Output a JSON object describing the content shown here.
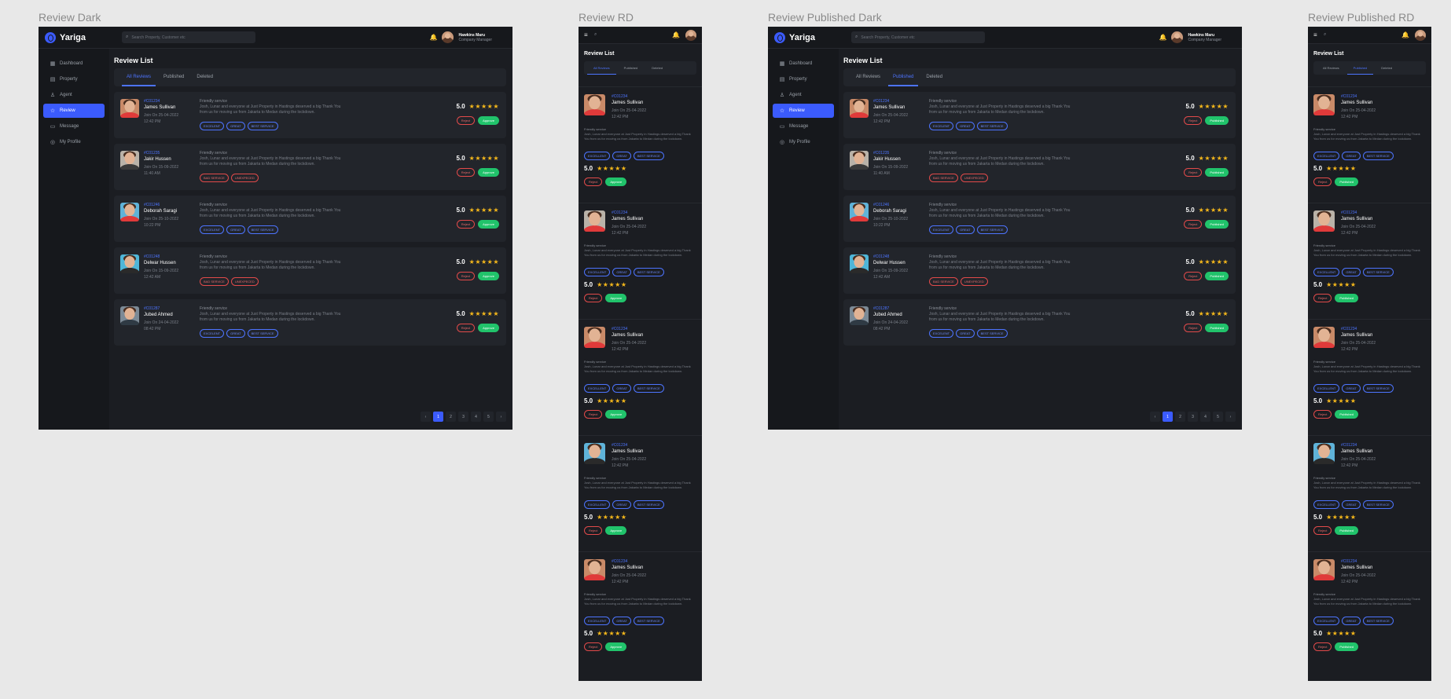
{
  "frames": {
    "review_dark": "Review Dark",
    "review_rd": "Review RD",
    "published_dark": "Review Published Dark",
    "published_rd": "Review Published RD"
  },
  "app": {
    "name": "Yariga"
  },
  "search": {
    "placeholder_dark": "Search Property, Customer etc",
    "placeholder_published": "Search Property, Customer etc"
  },
  "user": {
    "name": "Hawkins Maru",
    "role": "Company Manager"
  },
  "nav": [
    {
      "label": "Dashboard",
      "icon": "grid-icon"
    },
    {
      "label": "Property",
      "icon": "building-icon"
    },
    {
      "label": "Agent",
      "icon": "user-icon"
    },
    {
      "label": "Review",
      "icon": "star-icon"
    },
    {
      "label": "Message",
      "icon": "chat-icon"
    },
    {
      "label": "My Profile",
      "icon": "profile-icon"
    }
  ],
  "page_title": "Review List",
  "tabs": [
    "All Reviews",
    "Published",
    "Deleted"
  ],
  "buttons": {
    "reject": "Reject",
    "approve": "Approve",
    "published": "Published"
  },
  "reviews": [
    {
      "id": "#C01234",
      "name": "James Sullivan",
      "date": "Join On 25-04-2022",
      "time": "12:42 PM",
      "subject": "Friendly service",
      "text": "Josh, Lunar and everyone at Just Property in Hastings deserved a big Thank You from us for moving us from Jakarta to Medan during the lockdown.",
      "tags": [
        "EXCELENT",
        "GREAT",
        "BEST SERVICE"
      ],
      "tag_style": "blue",
      "score": "5.0",
      "avatar_bg": "#c98a68",
      "shirt": "#e03a3a"
    },
    {
      "id": "#C01235",
      "name": "Jakir Hussen",
      "date": "Join On 15-09-2022",
      "time": "11:40 AM",
      "subject": "Friendly service",
      "text": "Josh, Lunar and everyone at Just Property in Hastings deserved a big Thank You from us for moving us from Jakarta to Medan during the lockdown.",
      "tags": [
        "BAD SERVICE",
        "UNEXPECED"
      ],
      "tag_style": "red",
      "score": "5.0",
      "avatar_bg": "#b9b2a8",
      "shirt": "#3a3a3a"
    },
    {
      "id": "#C01246",
      "name": "Deborah Saragi",
      "date": "Join On 25-10-2022",
      "time": "10:22 PM",
      "subject": "Friendly service",
      "text": "Josh, Lunar and everyone at Just Property in Hastings deserved a big Thank You from us for moving us from Jakarta to Medan during the lockdown.",
      "tags": [
        "EXCELENT",
        "GREAT",
        "BEST SERVICE"
      ],
      "tag_style": "blue",
      "score": "5.0",
      "avatar_bg": "#5fb3d9",
      "shirt": "#e03a3a"
    },
    {
      "id": "#C01248",
      "name": "Delwar Hussen",
      "date": "Join On 15-09-2022",
      "time": "12:42 AM",
      "subject": "Friendly service",
      "text": "Josh, Lunar and everyone at Just Property in Hastings deserved a big Thank You from us for moving us from Jakarta to Medan during the lockdown.",
      "tags": [
        "BAD SERVICE",
        "UNEXPECED"
      ],
      "tag_style": "red",
      "score": "5.0",
      "avatar_bg": "#4fb6d8",
      "shirt": "#2a2a2a"
    },
    {
      "id": "#C01287",
      "name": "Jubed Ahmed",
      "date": "Join On 24-04-2022",
      "time": "08:42 PM",
      "subject": "Friendly service",
      "text": "Josh, Lunar and everyone at Just Property in Hastings deserved a big Thank You from us for moving us from Jakarta to Medan during the lockdown.",
      "tags": [
        "EXCELENT",
        "GREAT",
        "BEST SERVICE"
      ],
      "tag_style": "blue",
      "score": "5.0",
      "avatar_bg": "#7c8a96",
      "shirt": "#2f3a44"
    }
  ],
  "mobile_review": {
    "id": "#C01234",
    "name": "James Sullivan",
    "date": "Join On 25-04-2022",
    "time": "12:42 PM",
    "subject": "Friendly service",
    "text": "Josh, Lunar and everyone at Just Property in Hastings deserved a big Thank You from us for moving us from Jakarta to Medan during the lockdown.",
    "tags": [
      "EXCELLENT",
      "GREAT",
      "BEST SERVICE"
    ],
    "score": "5.0"
  },
  "mobile_avatars": [
    "#c98a68",
    "#b9b2a8",
    "#c98a68",
    "#5fb3d9",
    "#c98a68"
  ],
  "pagination": {
    "pages": [
      "1",
      "2",
      "3",
      "4",
      "5"
    ],
    "current": "1",
    "prev": "‹",
    "next": "›"
  },
  "icons": {
    "search": "⌕",
    "bell": "🔔",
    "menu": "≡",
    "star": "★"
  },
  "colors": {
    "accent": "#3b5bfd",
    "approve": "#21c36b",
    "reject": "#e24a4a",
    "star": "#f5b81b",
    "bg": "#1b1d22"
  }
}
